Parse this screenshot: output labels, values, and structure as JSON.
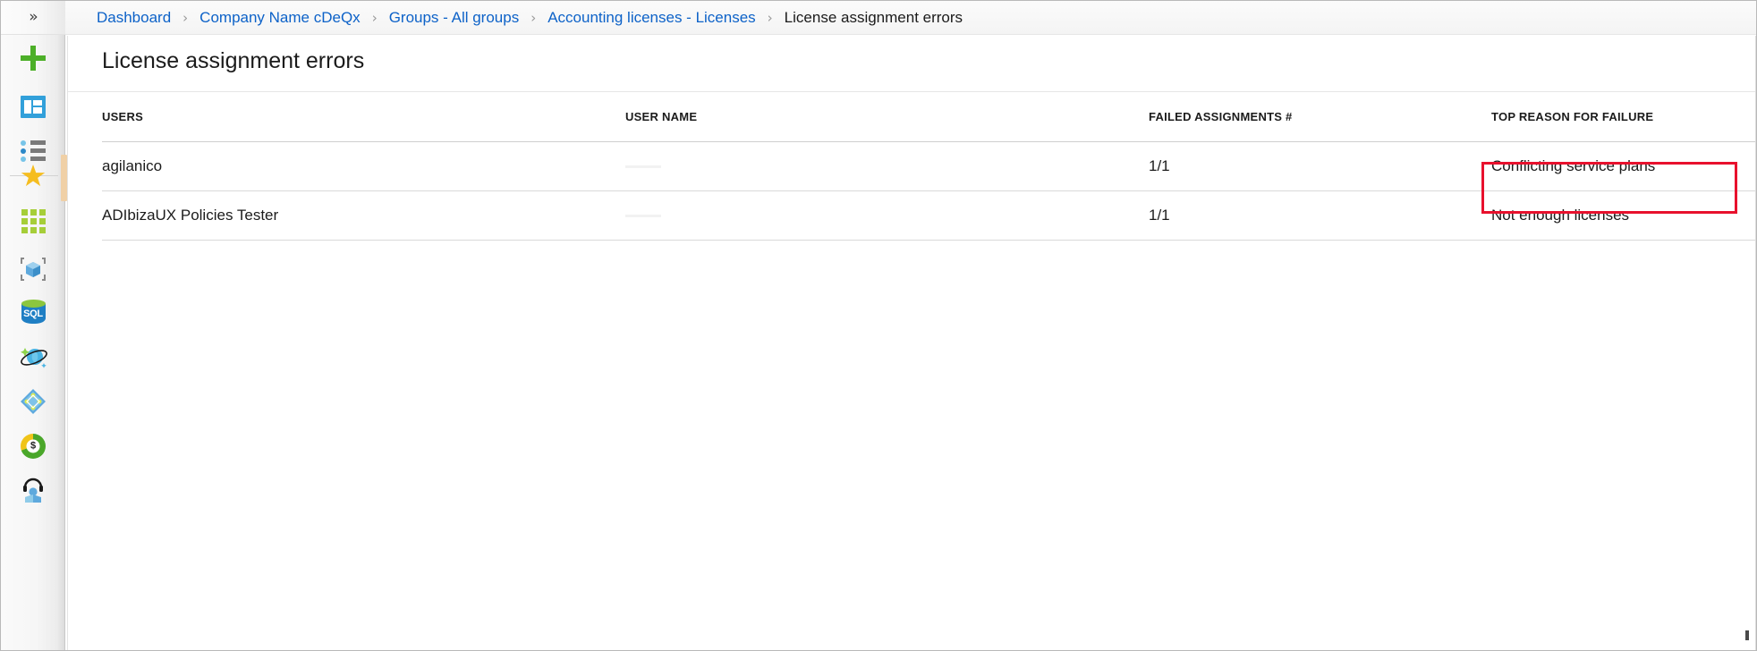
{
  "window": {
    "title": "License assignment errors"
  },
  "left_rail": {
    "expand_label": "»",
    "expand_name": "show-portal-menu",
    "items": [
      {
        "label": "Create a resource",
        "icon": "plus-icon"
      },
      {
        "label": "Dashboard",
        "icon": "dashboard-icon"
      },
      {
        "label": "All resources",
        "icon": "list-icon"
      },
      {
        "label": "Favorites",
        "icon": "star-icon"
      },
      {
        "label": "All services",
        "icon": "grid-icon"
      },
      {
        "label": "Resource groups",
        "icon": "resource-cube-icon"
      },
      {
        "label": "SQL databases",
        "icon": "sql-database-icon"
      },
      {
        "label": "Azure Cosmos DB",
        "icon": "cosmos-db-planet-icon"
      },
      {
        "label": "Azure Active Directory",
        "icon": "azure-active-directory-icon"
      },
      {
        "label": "Cost Management + Billing",
        "icon": "cost-management-donut-icon"
      },
      {
        "label": "Help + support",
        "icon": "help-support-icon"
      }
    ]
  },
  "breadcrumb": {
    "separator": "›",
    "items": [
      {
        "label": "Dashboard",
        "current": false
      },
      {
        "label": "Company Name cDeQx",
        "current": false
      },
      {
        "label": "Groups - All groups",
        "current": false
      },
      {
        "label": "Accounting licenses - Licenses",
        "current": false
      },
      {
        "label": "License assignment errors",
        "current": true
      }
    ]
  },
  "blade": {
    "title": "License assignment errors"
  },
  "grid": {
    "columns": [
      {
        "key": "users",
        "label": "USERS"
      },
      {
        "key": "user_name",
        "label": "USER NAME"
      },
      {
        "key": "failed_assignments",
        "label": "FAILED ASSIGNMENTS #"
      },
      {
        "key": "top_reason",
        "label": "TOP REASON FOR FAILURE"
      }
    ],
    "rows": [
      {
        "users": "agilanico",
        "user_name": "",
        "failed_assignments": "1/1",
        "top_reason": "Conflicting service plans",
        "highlighted": true
      },
      {
        "users": "ADIbizaUX Policies Tester",
        "user_name": "",
        "failed_assignments": "1/1",
        "top_reason": "Not enough licenses",
        "highlighted": false
      }
    ]
  },
  "colors": {
    "link": "#0d62c8",
    "text": "#1b1b1b",
    "highlight": "#e8112d",
    "rail_accent": "#f0d0a6",
    "grid_line": "#d9d9d9"
  }
}
